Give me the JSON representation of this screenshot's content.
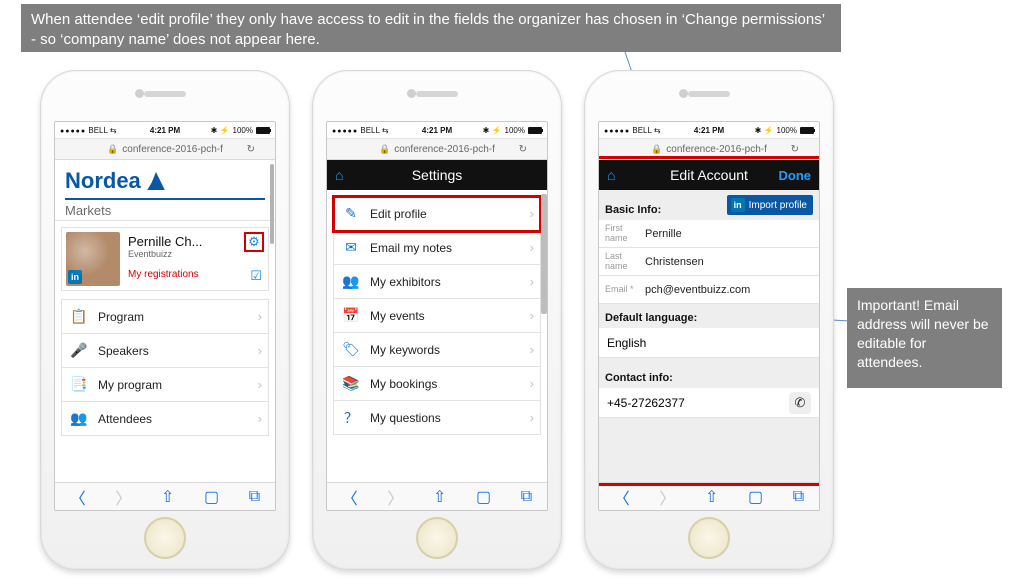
{
  "callouts": {
    "top": "When attendee ‘edit profile’ they only have access to edit in the fields the organizer has chosen in ‘Change permissions’ - so ‘company name’ does not appear here.",
    "right": "Important! Email address will never be editable for attendees."
  },
  "status": {
    "carrier": "BELL",
    "time": "4:21 PM",
    "battery": "100%"
  },
  "addressbar": {
    "url": "conference-2016-pch-f"
  },
  "phone1": {
    "brand_line1": "Nordea",
    "brand_line2": "Markets",
    "profile_name": "Pernille Ch...",
    "profile_org": "Eventbuizz",
    "my_registrations": "My registrations",
    "menu": [
      {
        "icon": "📋",
        "label": "Program"
      },
      {
        "icon": "🎤",
        "label": "Speakers"
      },
      {
        "icon": "📑",
        "label": "My program"
      },
      {
        "icon": "👥",
        "label": "Attendees"
      }
    ]
  },
  "phone2": {
    "title": "Settings",
    "items": [
      {
        "icon": "✎",
        "label": "Edit profile",
        "highlight": true
      },
      {
        "icon": "✉",
        "label": "Email my notes"
      },
      {
        "icon": "👥",
        "label": "My exhibitors"
      },
      {
        "icon": "📅",
        "label": "My events"
      },
      {
        "icon": "🏷",
        "label": "My keywords"
      },
      {
        "icon": "📚",
        "label": "My bookings"
      },
      {
        "icon": "？",
        "label": "My questions"
      }
    ]
  },
  "phone3": {
    "title": "Edit Account",
    "done": "Done",
    "import": "Import profile",
    "sections": {
      "basic": "Basic Info:",
      "lang": "Default language:",
      "contact": "Contact info:"
    },
    "fields": {
      "first_label": "First name",
      "first_value": "Pernille",
      "last_label": "Last name",
      "last_value": "Christensen",
      "email_label": "Email",
      "email_value": "pch@eventbuizz.com"
    },
    "language": "English",
    "phone": "+45-27262377"
  }
}
